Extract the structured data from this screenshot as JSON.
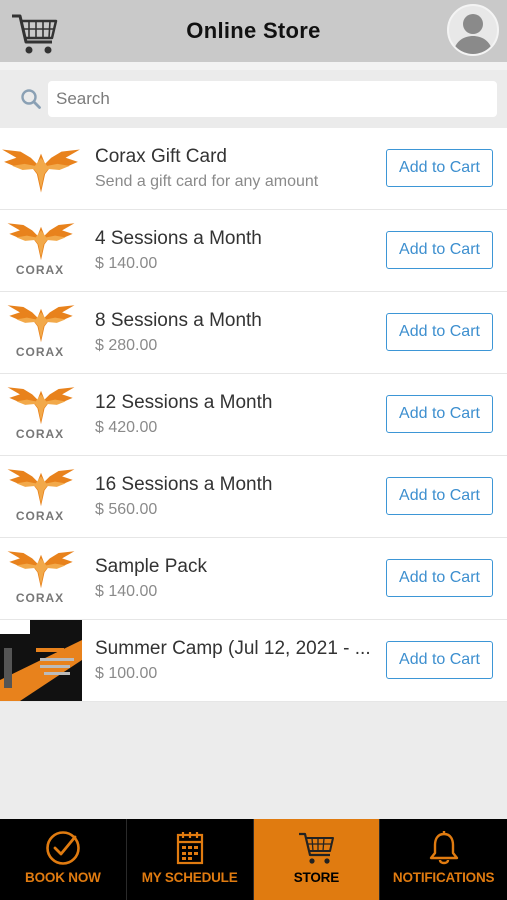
{
  "header": {
    "title": "Online Store"
  },
  "search": {
    "placeholder": "Search"
  },
  "products": [
    {
      "title": "Corax Gift Card",
      "subtitle": "Send a gift card for any amount",
      "button": "Add to Cart",
      "image": "gift-card-phoenix-logo"
    },
    {
      "title": "4 Sessions a Month",
      "subtitle": "$ 140.00",
      "button": "Add to Cart",
      "image": "corax-logo"
    },
    {
      "title": "8 Sessions a Month",
      "subtitle": "$ 280.00",
      "button": "Add to Cart",
      "image": "corax-logo"
    },
    {
      "title": "12 Sessions a Month",
      "subtitle": "$ 420.00",
      "button": "Add to Cart",
      "image": "corax-logo"
    },
    {
      "title": "16 Sessions a Month",
      "subtitle": "$ 560.00",
      "button": "Add to Cart",
      "image": "corax-logo"
    },
    {
      "title": "Sample Pack",
      "subtitle": "$ 140.00",
      "button": "Add to Cart",
      "image": "corax-logo"
    },
    {
      "title": "Summer Camp (Jul 12, 2021 - ...",
      "subtitle": "$ 100.00",
      "button": "Add to Cart",
      "image": "summer-camp-flyer"
    }
  ],
  "nav": {
    "items": [
      {
        "label": "BOOK NOW",
        "icon": "check-circle-icon",
        "active": false
      },
      {
        "label": "MY SCHEDULE",
        "icon": "calendar-icon",
        "active": false
      },
      {
        "label": "STORE",
        "icon": "cart-icon",
        "active": true
      },
      {
        "label": "NOTIFICATIONS",
        "icon": "bell-icon",
        "active": false
      }
    ]
  },
  "colors": {
    "accent": "#e07b10",
    "button_blue": "#3d96d6",
    "header_bg": "#c9c9c9"
  }
}
